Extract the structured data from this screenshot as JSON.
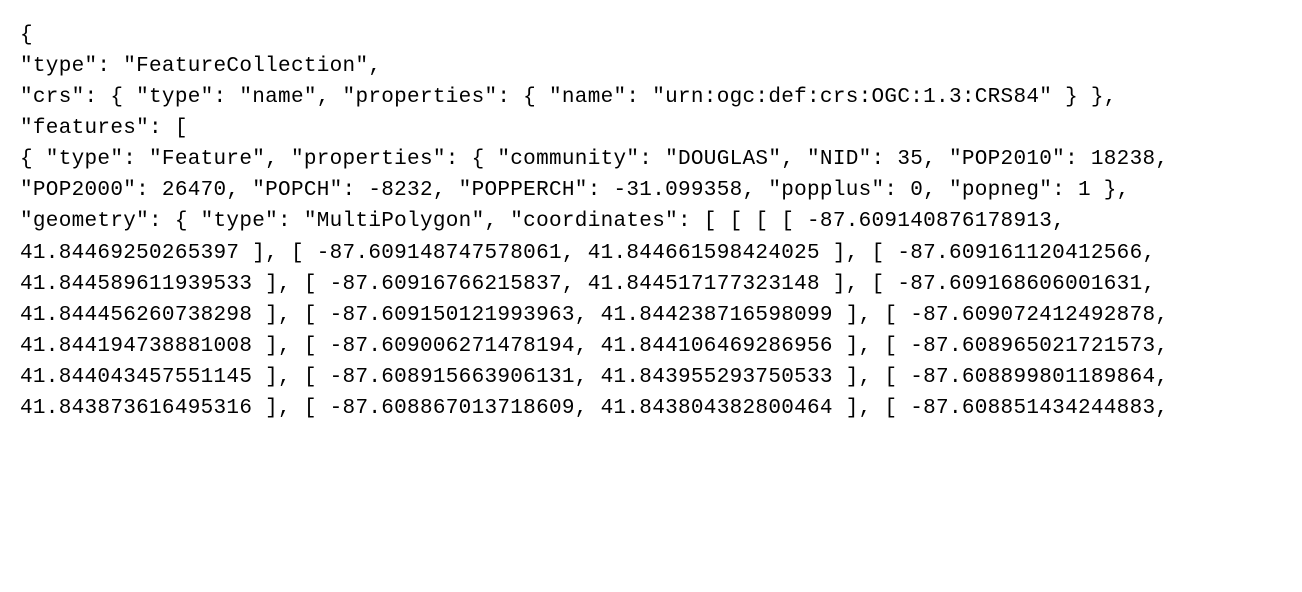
{
  "lines": [
    "{",
    "\"type\": \"FeatureCollection\",",
    "\"crs\": { \"type\": \"name\", \"properties\": { \"name\": \"urn:ogc:def:crs:OGC:1.3:CRS84\" } },",
    "\"features\": [",
    "{ \"type\": \"Feature\", \"properties\": { \"community\": \"DOUGLAS\", \"NID\": 35, \"POP2010\": 18238, \"POP2000\": 26470, \"POPCH\": -8232, \"POPPERCH\": -31.099358, \"popplus\": 0, \"popneg\": 1 }, \"geometry\": { \"type\": \"MultiPolygon\", \"coordinates\": [ [ [ [ -87.609140876178913, 41.84469250265397 ], [ -87.609148747578061, 41.844661598424025 ], [ -87.609161120412566, 41.844589611939533 ], [ -87.60916766215837, 41.844517177323148 ], [ -87.609168606001631, 41.844456260738298 ], [ -87.609150121993963, 41.844238716598099 ], [ -87.609072412492878, 41.844194738881008 ], [ -87.609006271478194, 41.844106469286956 ], [ -87.608965021721573, 41.844043457551145 ], [ -87.608915663906131, 41.843955293750533 ], [ -87.608899801189864, 41.843873616495316 ], [ -87.608867013718609, 41.843804382800464 ], [ -87.608851434244883,"
  ]
}
